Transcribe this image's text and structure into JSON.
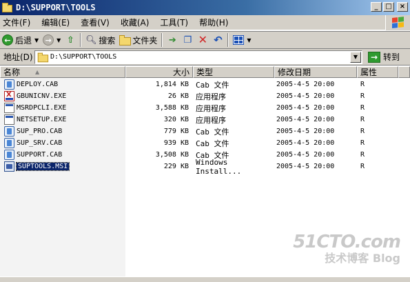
{
  "window": {
    "title": "D:\\SUPPORT\\TOOLS"
  },
  "menu": [
    {
      "label": "文件(F)"
    },
    {
      "label": "编辑(E)"
    },
    {
      "label": "查看(V)"
    },
    {
      "label": "收藏(A)"
    },
    {
      "label": "工具(T)"
    },
    {
      "label": "帮助(H)"
    }
  ],
  "toolbar": {
    "back_label": "后退",
    "search_label": "搜索",
    "folders_label": "文件夹"
  },
  "address": {
    "label": "地址(D)",
    "value": "D:\\SUPPORT\\TOOLS",
    "go_label": "转到"
  },
  "columns": {
    "name": "名称",
    "size": "大小",
    "type": "类型",
    "modified": "修改日期",
    "attr": "属性"
  },
  "files": [
    {
      "name": "DEPLOY.CAB",
      "size": "1,814 KB",
      "type": "Cab 文件",
      "modified": "2005-4-5 20:00",
      "attr": "R",
      "icon": "cab-file-icon"
    },
    {
      "name": "GBUNICNV.EXE",
      "size": "26 KB",
      "type": "应用程序",
      "modified": "2005-4-5 20:00",
      "attr": "R",
      "icon": "gbunicnv-app-icon"
    },
    {
      "name": "MSRDPCLI.EXE",
      "size": "3,588 KB",
      "type": "应用程序",
      "modified": "2005-4-5 20:00",
      "attr": "R",
      "icon": "exe-file-icon"
    },
    {
      "name": "NETSETUP.EXE",
      "size": "320 KB",
      "type": "应用程序",
      "modified": "2005-4-5 20:00",
      "attr": "R",
      "icon": "exe-file-icon"
    },
    {
      "name": "SUP_PRO.CAB",
      "size": "779 KB",
      "type": "Cab 文件",
      "modified": "2005-4-5 20:00",
      "attr": "R",
      "icon": "cab-file-icon"
    },
    {
      "name": "SUP_SRV.CAB",
      "size": "939 KB",
      "type": "Cab 文件",
      "modified": "2005-4-5 20:00",
      "attr": "R",
      "icon": "cab-file-icon"
    },
    {
      "name": "SUPPORT.CAB",
      "size": "3,508 KB",
      "type": "Cab 文件",
      "modified": "2005-4-5 20:00",
      "attr": "R",
      "icon": "cab-file-icon"
    },
    {
      "name": "SUPTOOLS.MSI",
      "size": "229 KB",
      "type": "Windows Install...",
      "modified": "2005-4-5 20:00",
      "attr": "R",
      "icon": "msi-file-icon",
      "selected": true
    }
  ],
  "watermark": {
    "main": "51CTO.com",
    "sub": "技术博客  Blog"
  },
  "colors": {
    "titlebar_start": "#0a246a",
    "titlebar_end": "#a6caf0",
    "chrome": "#d4d0c8",
    "selection": "#0a246a"
  }
}
